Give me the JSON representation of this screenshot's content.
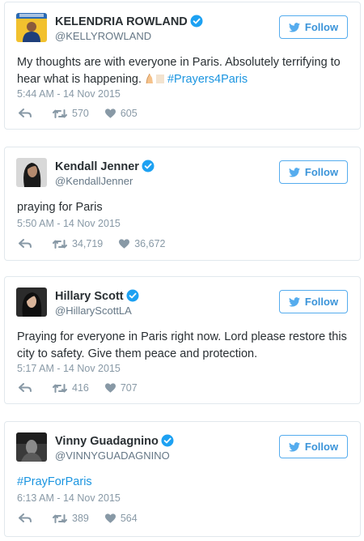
{
  "tweets": [
    {
      "name": "KELENDRIA ROWLAND",
      "handle": "@KELLYROWLAND",
      "follow_label": "Follow",
      "text_lines": [
        "My thoughts are with everyone in Paris. Absolutely terrifying to",
        "hear what is happening."
      ],
      "hashtag": "#Prayers4Paris",
      "time": "5:44 AM - 14 Nov 2015",
      "retweets": "570",
      "likes": "605"
    },
    {
      "name": "Kendall Jenner",
      "handle": "@KendallJenner",
      "follow_label": "Follow",
      "text": "praying for Paris",
      "time": "5:50 AM - 14 Nov 2015",
      "retweets": "34,719",
      "likes": "36,672"
    },
    {
      "name": "Hillary Scott",
      "handle": "@HillaryScottLA",
      "follow_label": "Follow",
      "text": "Praying for everyone in Paris right now. Lord please restore this city to safety. Give them peace and protection.",
      "time": "5:17 AM - 14 Nov 2015",
      "retweets": "416",
      "likes": "707"
    },
    {
      "name": "Vinny Guadagnino",
      "handle": "@VINNYGUADAGNINO",
      "follow_label": "Follow",
      "hashtag": "#PrayForParis",
      "time": "6:13 AM - 14 Nov 2015",
      "retweets": "389",
      "likes": "564"
    }
  ],
  "icons": {
    "verified": "verified-badge-icon",
    "follow": "twitter-bird-icon",
    "reply": "reply-arrow-icon",
    "retweet": "retweet-icon",
    "like": "heart-icon",
    "emoji": "praying-hands-icon"
  },
  "colors": {
    "twitter_blue": "#55acee",
    "link_blue": "#1b95e0",
    "muted_text": "#8899a6",
    "body_text": "#292f33",
    "card_border": "#e1e8ed"
  }
}
